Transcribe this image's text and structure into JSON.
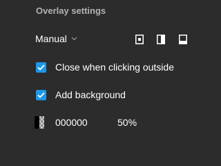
{
  "header": {
    "title": "Overlay settings"
  },
  "mode": {
    "selected": "Manual"
  },
  "position_icons": [
    "overlay-center-icon",
    "overlay-right-icon",
    "overlay-bottom-icon"
  ],
  "options": [
    {
      "label": "Close when clicking outside",
      "checked": true
    },
    {
      "label": "Add background",
      "checked": true
    }
  ],
  "background": {
    "color": "000000",
    "opacity": "50%"
  },
  "colors": {
    "panel_bg": "#2c2c2c",
    "title": "#b3b3b3",
    "text": "#ffffff",
    "checkbox": "#1d98e8"
  }
}
